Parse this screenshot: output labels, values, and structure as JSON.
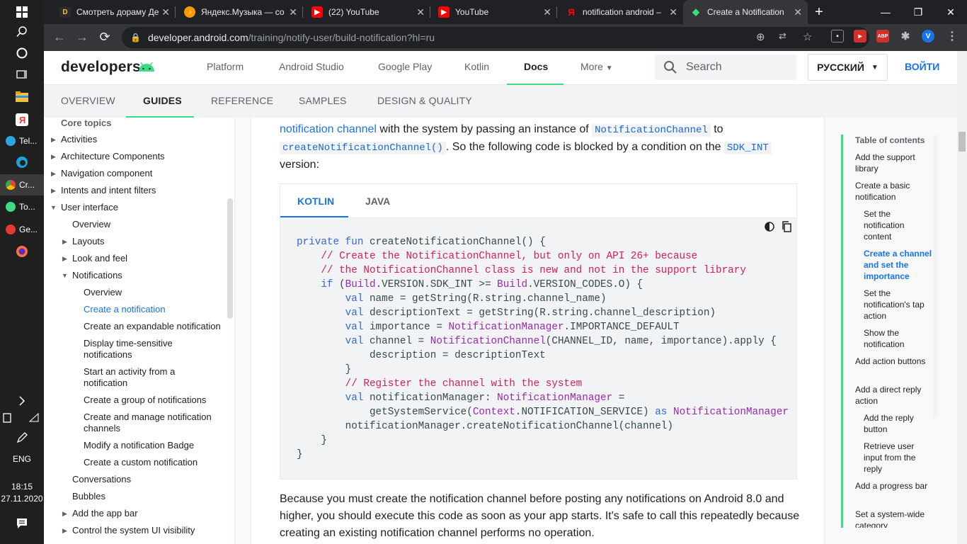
{
  "taskbar": {
    "apps": [
      {
        "label": "Tel...",
        "color": "#2ca5e0",
        "active": false
      },
      {
        "label": "Cr...",
        "color": "#34a853",
        "active": true
      },
      {
        "label": "To...",
        "color": "#3ddc84",
        "active": false
      },
      {
        "label": "Ge...",
        "color": "#e53935",
        "active": false
      }
    ],
    "lang": "ENG",
    "time": "18:15",
    "date": "27.11.2020"
  },
  "browser": {
    "tabs": [
      {
        "title": "Смотреть дораму Де",
        "fav": "D",
        "favColor": "#2b2b2b"
      },
      {
        "title": "Яндекс.Музыка — со",
        "fav": "♪",
        "favColor": "#ff9900"
      },
      {
        "title": "(22) YouTube",
        "fav": "▶",
        "favColor": "#ff0000"
      },
      {
        "title": "YouTube",
        "fav": "▶",
        "favColor": "#ff0000"
      },
      {
        "title": "notification android –",
        "fav": "Я",
        "favColor": "#202124"
      },
      {
        "title": "Create a Notification",
        "fav": "◆",
        "favColor": "#3ddc84"
      }
    ],
    "url_host": "developer.android.com",
    "url_path": "/training/notify-user/build-notification?hl=ru",
    "profile_initial": "V"
  },
  "header": {
    "logo": "developers",
    "nav": [
      "Platform",
      "Android Studio",
      "Google Play",
      "Kotlin",
      "Docs",
      "More"
    ],
    "active_nav": "Docs",
    "search_placeholder": "Search",
    "lang": "РУССКИЙ",
    "signin": "ВОЙТИ"
  },
  "subnav": {
    "tabs": [
      "OVERVIEW",
      "GUIDES",
      "REFERENCE",
      "SAMPLES",
      "DESIGN & QUALITY"
    ],
    "active": "GUIDES"
  },
  "leftnav": {
    "items": [
      {
        "label": "Core topics",
        "type": "head"
      },
      {
        "label": "Activities",
        "type": "collapsed"
      },
      {
        "label": "Architecture Components",
        "type": "collapsed"
      },
      {
        "label": "Navigation component",
        "type": "collapsed"
      },
      {
        "label": "Intents and intent filters",
        "type": "collapsed"
      },
      {
        "label": "User interface",
        "type": "expanded"
      },
      {
        "label": "Overview",
        "type": "sub"
      },
      {
        "label": "Layouts",
        "type": "subcollapsed"
      },
      {
        "label": "Look and feel",
        "type": "subcollapsed"
      },
      {
        "label": "Notifications",
        "type": "subexpanded"
      },
      {
        "label": "Overview",
        "type": "subsub"
      },
      {
        "label": "Create a notification",
        "type": "current"
      },
      {
        "label": "Create an expandable notification",
        "type": "subsub"
      },
      {
        "label": "Display time-sensitive notifications",
        "type": "subsub"
      },
      {
        "label": "Start an activity from a notification",
        "type": "subsub"
      },
      {
        "label": "Create a group of notifications",
        "type": "subsub"
      },
      {
        "label": "Create and manage notification channels",
        "type": "subsub"
      },
      {
        "label": "Modify a notification Badge",
        "type": "subsub"
      },
      {
        "label": "Create a custom notification",
        "type": "subsub"
      },
      {
        "label": "Conversations",
        "type": "sub"
      },
      {
        "label": "Bubbles",
        "type": "sub"
      },
      {
        "label": "Add the app bar",
        "type": "subcollapsed"
      },
      {
        "label": "Control the system UI visibility",
        "type": "subcollapsed"
      }
    ]
  },
  "article": {
    "para1_link": "notification channel",
    "para1_a": " with the system by passing an instance of ",
    "para1_code1": "NotificationChannel",
    "para1_b": " to",
    "para1_code2": "createNotificationChannel()",
    "para1_c": ". So the following code is blocked by a condition on the ",
    "para1_code3": "SDK_INT",
    "para1_d": "version:",
    "code_tabs": [
      "KOTLIN",
      "JAVA"
    ],
    "active_code_tab": "KOTLIN",
    "para2": "Because you must create the notification channel before posting any notifications on Android 8.0 and higher, you should execute this code as soon as your app starts. It's safe to call this repeatedly because creating an existing notification channel performs no operation."
  },
  "toc": {
    "title": "Table of contents",
    "items": [
      {
        "label": "Add the support library",
        "level": 1
      },
      {
        "label": "Create a basic notification",
        "level": 1
      },
      {
        "label": "Set the notification content",
        "level": 2
      },
      {
        "label": "Create a channel and set the importance",
        "level": 2,
        "current": true
      },
      {
        "label": "Set the notification's tap action",
        "level": 2
      },
      {
        "label": "Show the notification",
        "level": 2
      },
      {
        "label": "Add action buttons",
        "level": 1
      },
      {
        "label": "Add a direct reply action",
        "level": 1
      },
      {
        "label": "Add the reply button",
        "level": 2
      },
      {
        "label": "Retrieve user input from the reply",
        "level": 2
      },
      {
        "label": "Add a progress bar",
        "level": 1
      },
      {
        "label": "Set a system-wide category",
        "level": 1
      }
    ]
  }
}
